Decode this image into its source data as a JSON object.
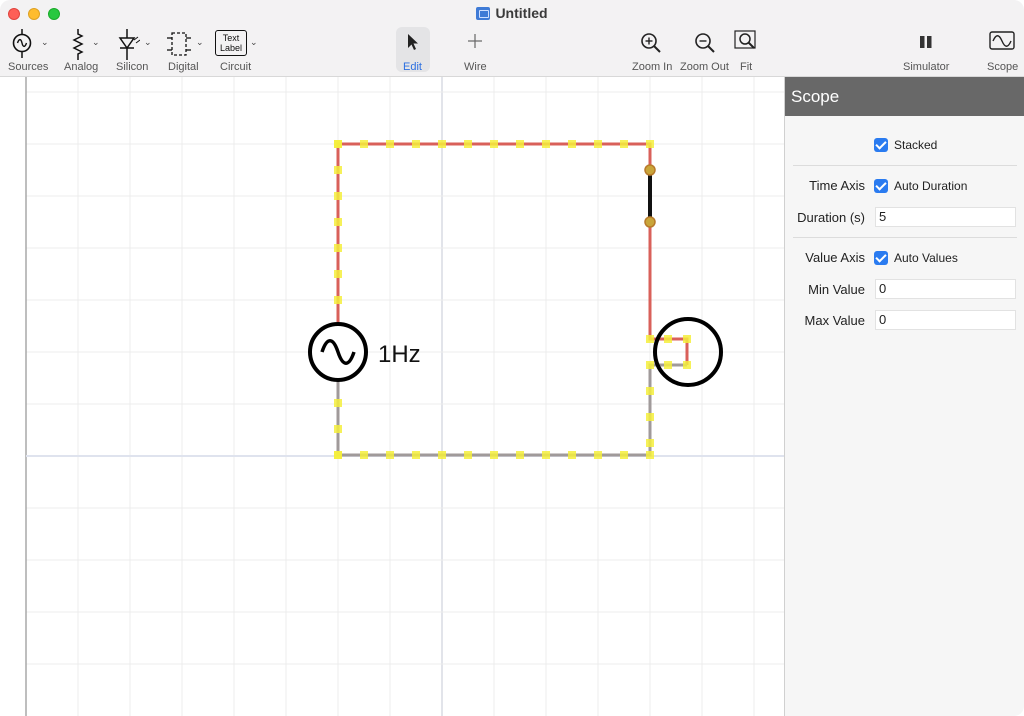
{
  "window": {
    "title": "Untitled"
  },
  "toolbar": {
    "sources_label": "Sources",
    "analog_label": "Analog",
    "silicon_label": "Silicon",
    "digital_label": "Digital",
    "circuit_label": "Circuit",
    "circuit_icon_line1": "Text",
    "circuit_icon_line2": "Label",
    "edit_label": "Edit",
    "wire_label": "Wire",
    "zoom_in_label": "Zoom In",
    "zoom_out_label": "Zoom Out",
    "fit_label": "Fit",
    "simulator_label": "Simulator",
    "scope_label": "Scope"
  },
  "canvas": {
    "source_label": "1Hz",
    "colors": {
      "wire_live": "#d9605a",
      "wire_neutral": "#a09a9a",
      "selection": "#f5ef3c",
      "grid": "#ececec"
    }
  },
  "panel": {
    "title": "Scope",
    "stacked_label": "Stacked",
    "stacked_checked": true,
    "time_axis_label": "Time Axis",
    "auto_duration_label": "Auto Duration",
    "auto_duration_checked": true,
    "duration_label": "Duration (s)",
    "duration_value": "5",
    "value_axis_label": "Value Axis",
    "auto_values_label": "Auto Values",
    "auto_values_checked": true,
    "min_value_label": "Min Value",
    "min_value": "0",
    "max_value_label": "Max Value",
    "max_value": "0"
  }
}
